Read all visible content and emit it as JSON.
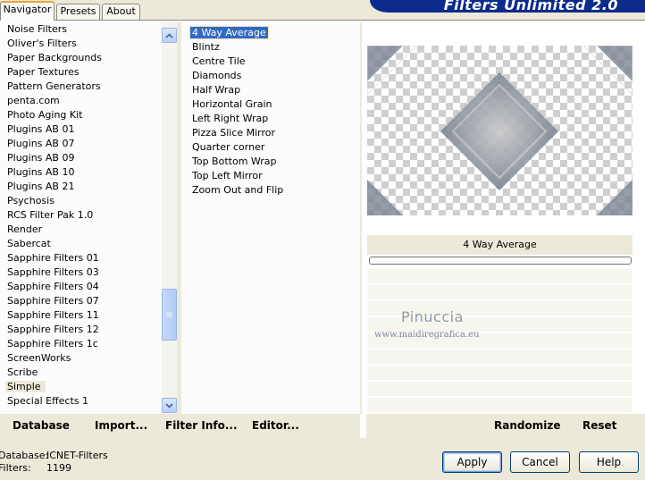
{
  "tabs": [
    {
      "label": "Navigator",
      "active": true
    },
    {
      "label": "Presets",
      "active": false
    },
    {
      "label": "About",
      "active": false
    }
  ],
  "banner": {
    "title": "Filters Unlimited 2.0"
  },
  "categories": {
    "items": [
      "Noise Filters",
      "Oliver's Filters",
      "Paper Backgrounds",
      "Paper Textures",
      "Pattern Generators",
      "penta.com",
      "Photo Aging Kit",
      "Plugins AB 01",
      "Plugins AB 07",
      "Plugins AB 09",
      "Plugins AB 10",
      "Plugins AB 21",
      "Psychosis",
      "RCS Filter Pak 1.0",
      "Render",
      "Sabercat",
      "Sapphire Filters 01",
      "Sapphire Filters 03",
      "Sapphire Filters 04",
      "Sapphire Filters 07",
      "Sapphire Filters 11",
      "Sapphire Filters 12",
      "Sapphire Filters 1c",
      "ScreenWorks",
      "Scribe",
      "Simple",
      "Special Effects 1"
    ],
    "selected": "Simple"
  },
  "filters": {
    "items": [
      "4 Way Average",
      "Blintz",
      "Centre Tile",
      "Diamonds",
      "Half Wrap",
      "Horizontal Grain",
      "Left Right Wrap",
      "Pizza Slice Mirror",
      "Quarter corner",
      "Top Bottom Wrap",
      "Top Left Mirror",
      "Zoom Out and Flip"
    ],
    "selected": "4 Way Average"
  },
  "preview": {
    "caption": "4 Way Average",
    "progress": 0,
    "watermark_title": "Pinuccia",
    "watermark_url": "www.maidiregrafica.eu"
  },
  "toolbar": {
    "database": "Database",
    "import": "Import...",
    "filter_info": "Filter Info...",
    "editor": "Editor...",
    "randomize": "Randomize",
    "reset": "Reset"
  },
  "footer": {
    "database_label": "Database:",
    "database_value": "ICNET-Filters",
    "filters_label": "Filters:",
    "filters_value": "1199"
  },
  "buttons": {
    "apply": "Apply",
    "cancel": "Cancel",
    "help": "Help"
  },
  "colors": {
    "selection": "#316ac5",
    "banner": "#0c2b8c",
    "face": "#ece9d8"
  }
}
